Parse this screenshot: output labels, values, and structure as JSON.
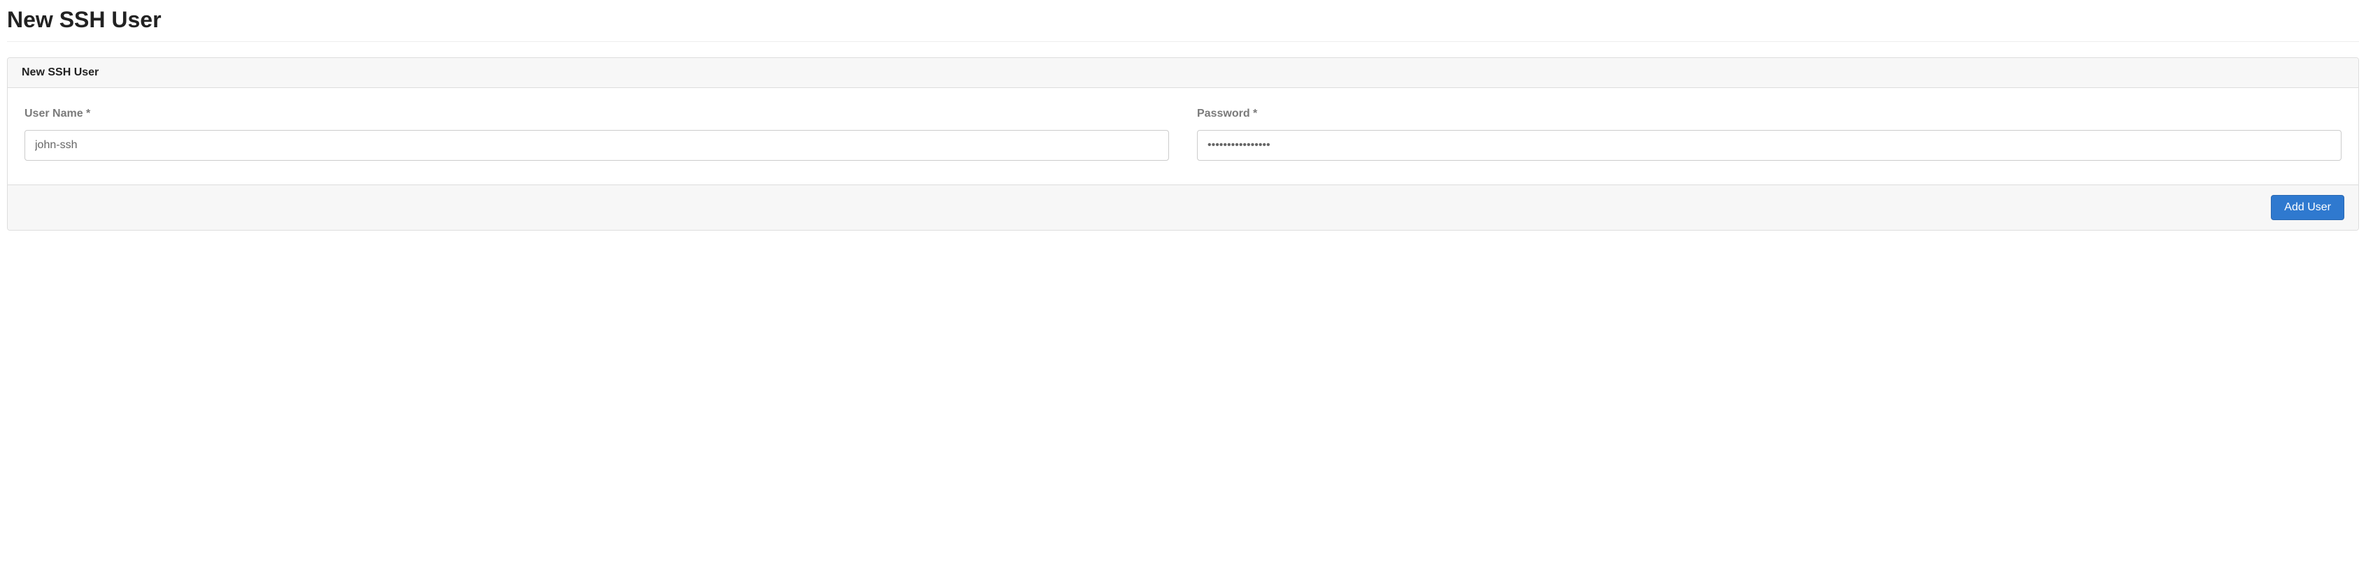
{
  "page": {
    "title": "New SSH User"
  },
  "panel": {
    "header": "New SSH User",
    "footer": {
      "submit_label": "Add User"
    }
  },
  "form": {
    "username": {
      "label": "User Name *",
      "value": "john-ssh",
      "placeholder": ""
    },
    "password": {
      "label": "Password *",
      "value": "****************",
      "placeholder": ""
    }
  }
}
